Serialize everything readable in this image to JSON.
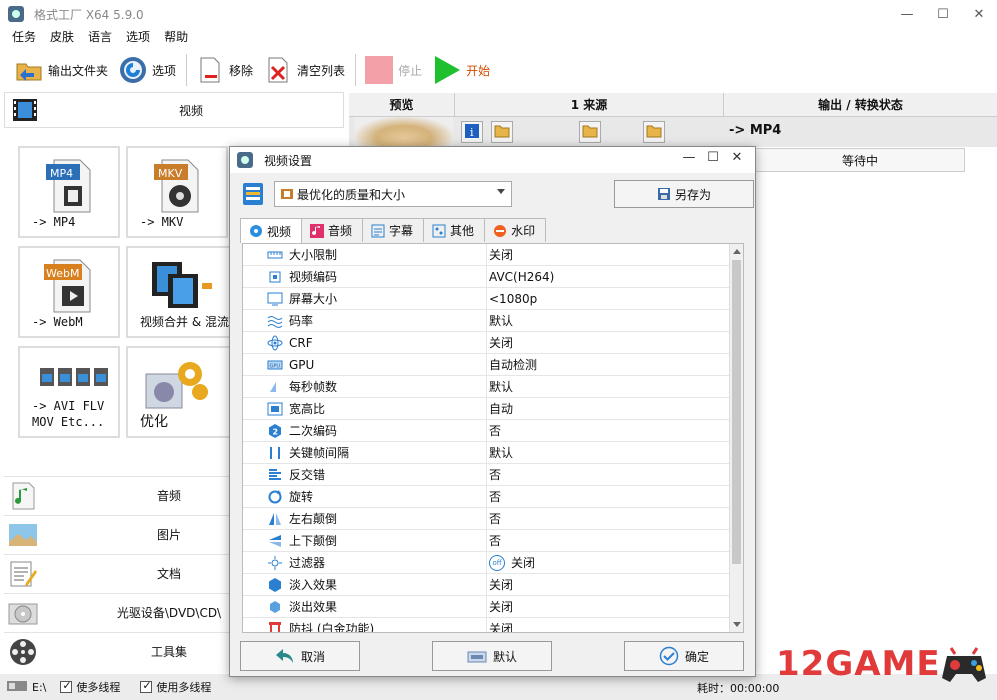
{
  "window": {
    "title": "格式工厂 X64 5.9.0",
    "controls": [
      "—",
      "☐",
      "✕"
    ]
  },
  "menu": [
    "任务",
    "皮肤",
    "语言",
    "选项",
    "帮助"
  ],
  "toolbar": {
    "output_folder": "输出文件夹",
    "options": "选项",
    "remove": "移除",
    "clear_list": "清空列表",
    "stop": "停止",
    "start": "开始"
  },
  "left": {
    "video_category": "视频",
    "tiles": [
      {
        "label": "-> MP4",
        "icon": "mp4-file-icon",
        "badge": "MP4"
      },
      {
        "label": "-> MKV",
        "icon": "mkv-file-icon",
        "badge": "MKV"
      },
      {
        "label": "-> WebM",
        "icon": "webm-file-icon",
        "badge": "WebM"
      },
      {
        "label": "视频合并 & 混流",
        "icon": "film-merge-icon"
      },
      {
        "label": "-> AVI FLV\nMOV Etc...",
        "icon": "multi-format-icon"
      },
      {
        "label": "优化",
        "icon": "optimize-gear-icon"
      }
    ],
    "categories": [
      "音频",
      "图片",
      "文档",
      "光驱设备\\DVD\\CD\\",
      "工具集"
    ]
  },
  "queue": {
    "headers": [
      "预览",
      "1 来源",
      "输出 / 转换状态"
    ],
    "output": "-> MP4",
    "status": "等待中"
  },
  "statusbar": {
    "path": "E:\\",
    "multithread": "使多线程",
    "use_multithread": "使用多线程",
    "elapsed": "耗时：00:00:00"
  },
  "watermark": "12GAME",
  "dialog": {
    "title": "视频设置",
    "preset": "最优化的质量和大小",
    "save_as": "另存为",
    "tabs": [
      "视频",
      "音频",
      "字幕",
      "其他",
      "水印"
    ],
    "properties": [
      {
        "name": "大小限制",
        "value": "关闭",
        "icon": "ruler-icon"
      },
      {
        "name": "视频编码",
        "value": "AVC(H264)",
        "icon": "chip-icon"
      },
      {
        "name": "屏幕大小",
        "value": "<1080p",
        "icon": "monitor-icon"
      },
      {
        "name": "码率",
        "value": "默认",
        "icon": "wave-icon"
      },
      {
        "name": "CRF",
        "value": "关闭",
        "icon": "atom-icon"
      },
      {
        "name": "GPU",
        "value": "自动检测",
        "icon": "gpu-icon"
      },
      {
        "name": "每秒帧数",
        "value": "默认",
        "icon": "fps-icon"
      },
      {
        "name": "宽高比",
        "value": "自动",
        "icon": "aspect-icon"
      },
      {
        "name": "二次编码",
        "value": "否",
        "icon": "two-pass-icon"
      },
      {
        "name": "关键帧间隔",
        "value": "默认",
        "icon": "keyframe-icon"
      },
      {
        "name": "反交错",
        "value": "否",
        "icon": "deinterlace-icon"
      },
      {
        "name": "旋转",
        "value": "否",
        "icon": "rotate-icon"
      },
      {
        "name": "左右颠倒",
        "value": "否",
        "icon": "flip-horizontal-icon"
      },
      {
        "name": "上下颠倒",
        "value": "否",
        "icon": "flip-vertical-icon"
      },
      {
        "name": "过滤器",
        "value": "关闭",
        "icon": "filter-icon",
        "badge": "off"
      },
      {
        "name": "淡入效果",
        "value": "关闭",
        "icon": "fade-in-icon"
      },
      {
        "name": "淡出效果",
        "value": "关闭",
        "icon": "fade-out-icon"
      },
      {
        "name": "防抖 (白金功能)",
        "value": "关闭",
        "icon": "stabilize-icon"
      }
    ],
    "cancel": "取消",
    "default": "默认",
    "ok": "确定"
  },
  "colors": {
    "accent_blue": "#1e7fd6",
    "start_green": "#1fbf2e",
    "stop_pink": "#f4a0a8",
    "watermark_red": "#e03a3a"
  }
}
